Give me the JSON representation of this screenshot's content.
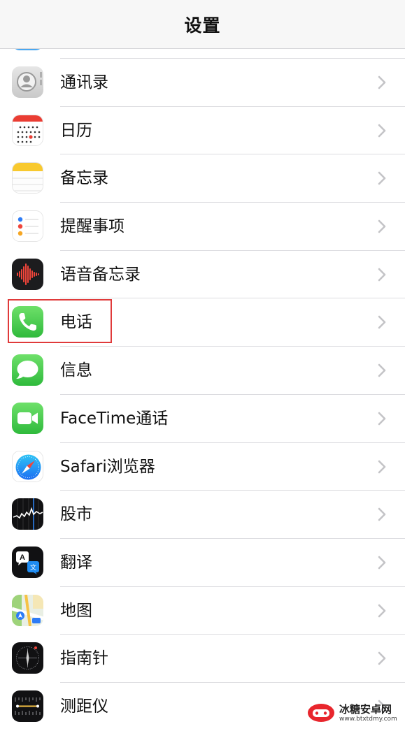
{
  "navbar": {
    "title": "设置"
  },
  "rows": [
    {
      "name": "contacts",
      "label": "通讯录",
      "icon": "contacts-icon"
    },
    {
      "name": "calendar",
      "label": "日历",
      "icon": "calendar-icon"
    },
    {
      "name": "notes",
      "label": "备忘录",
      "icon": "notes-icon"
    },
    {
      "name": "reminders",
      "label": "提醒事项",
      "icon": "reminders-icon"
    },
    {
      "name": "voice-memos",
      "label": "语音备忘录",
      "icon": "voice-memos-icon"
    },
    {
      "name": "phone",
      "label": "电话",
      "icon": "phone-icon",
      "highlighted": true
    },
    {
      "name": "messages",
      "label": "信息",
      "icon": "messages-icon"
    },
    {
      "name": "facetime",
      "label": "FaceTime通话",
      "icon": "facetime-icon"
    },
    {
      "name": "safari",
      "label": "Safari浏览器",
      "icon": "safari-icon"
    },
    {
      "name": "stocks",
      "label": "股市",
      "icon": "stocks-icon"
    },
    {
      "name": "translate",
      "label": "翻译",
      "icon": "translate-icon"
    },
    {
      "name": "maps",
      "label": "地图",
      "icon": "maps-icon"
    },
    {
      "name": "compass",
      "label": "指南针",
      "icon": "compass-icon"
    },
    {
      "name": "measure",
      "label": "测距仪",
      "icon": "measure-icon"
    }
  ],
  "watermark": {
    "title": "冰糖安卓网",
    "url": "www.btxtdmy.com"
  },
  "colors": {
    "highlight": "#e03a3a",
    "chevron": "#c4c4c7",
    "separator": "#dcdce0"
  }
}
